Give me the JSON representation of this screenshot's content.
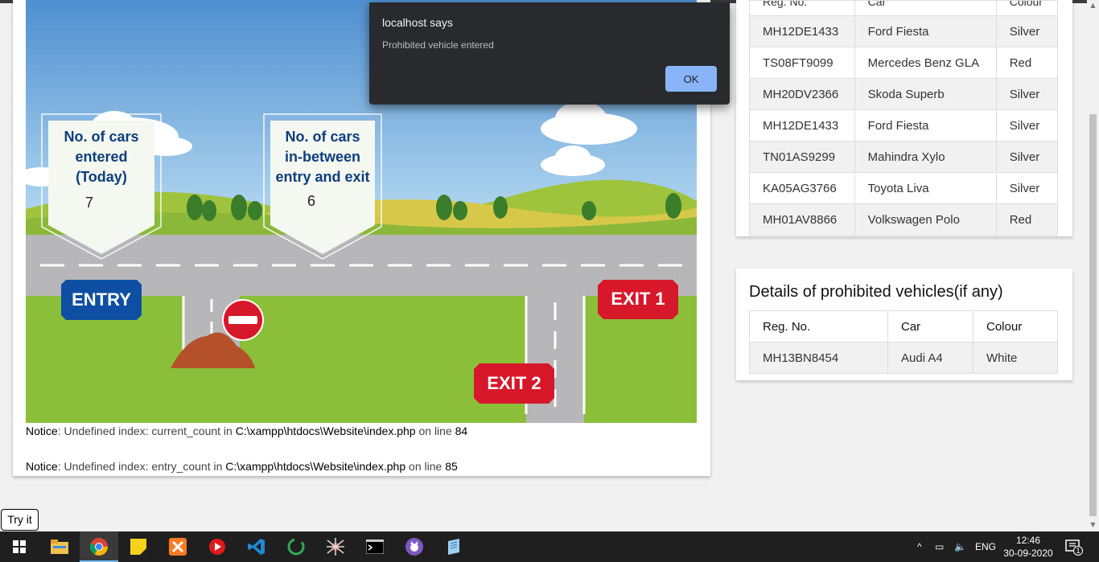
{
  "dialog": {
    "title": "localhost says",
    "message": "Prohibited vehicle entered",
    "ok_label": "OK"
  },
  "scene": {
    "sign_entered_label": [
      "No. of cars",
      "entered",
      "(Today)"
    ],
    "sign_entered_value": "7",
    "sign_between_label": [
      "No. of cars",
      "in-between",
      "entry and exit"
    ],
    "sign_between_value": "6",
    "entry_label": "ENTRY",
    "exit1_label": "EXIT 1",
    "exit2_label": "EXIT 2"
  },
  "notices": [
    {
      "prefix": "Notice",
      "text": ": Undefined index: current_count in ",
      "path": "C:\\xampp\\htdocs\\Website\\index.php",
      "line_text": " on line ",
      "line": "84"
    },
    {
      "prefix": "Notice",
      "text": ": Undefined index: entry_count in ",
      "path": "C:\\xampp\\htdocs\\Website\\index.php",
      "line_text": " on line ",
      "line": "85"
    }
  ],
  "vehicle_table": {
    "headers": [
      "Reg. No.",
      "Car",
      "Colour"
    ],
    "rows": [
      [
        "MH12DE1433",
        "Ford Fiesta",
        "Silver"
      ],
      [
        "TS08FT9099",
        "Mercedes Benz GLA",
        "Red"
      ],
      [
        "MH20DV2366",
        "Skoda Superb",
        "Silver"
      ],
      [
        "MH12DE1433",
        "Ford Fiesta",
        "Silver"
      ],
      [
        "TN01AS9299",
        "Mahindra Xylo",
        "Silver"
      ],
      [
        "KA05AG3766",
        "Toyota Liva",
        "Silver"
      ],
      [
        "MH01AV8866",
        "Volkswagen Polo",
        "Red"
      ]
    ]
  },
  "prohibited": {
    "title": "Details of prohibited vehicles(if any)",
    "headers": [
      "Reg. No.",
      "Car",
      "Colour"
    ],
    "rows": [
      [
        "MH13BN8454",
        "Audi A4",
        "White"
      ]
    ]
  },
  "try_it_label": "Try it",
  "taskbar": {
    "icons": [
      "windows-start-icon",
      "file-explorer-icon",
      "chrome-icon",
      "sticky-notes-icon",
      "xampp-icon",
      "media-player-icon",
      "vscode-icon",
      "circle-app-icon",
      "spider-app-icon",
      "terminal-icon",
      "cat-app-icon",
      "notepad-icon"
    ],
    "language": "ENG",
    "time": "12:46",
    "date": "30-09-2020",
    "notification_count": "1"
  },
  "colors": {
    "dialog_bg": "#292a2d",
    "ok_button": "#8ab4f8",
    "entry_sign": "#0e4fa3",
    "exit_sign": "#d7182a",
    "sign_text": "#0d3e7a"
  }
}
